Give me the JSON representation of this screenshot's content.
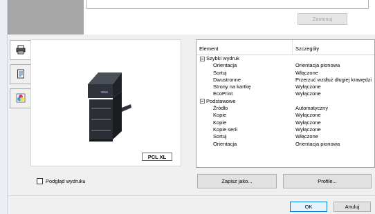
{
  "top": {
    "apply_label": "Zastosuj"
  },
  "tabs": [
    {
      "icon": "printer-settings-icon"
    },
    {
      "icon": "document-icon"
    },
    {
      "icon": "color-icon"
    }
  ],
  "preview": {
    "badge": "PCL XL"
  },
  "grid": {
    "headers": {
      "element": "Element",
      "details": "Szczegóły"
    },
    "rows": [
      {
        "type": "group",
        "element": "Szybki wydruk",
        "details": ""
      },
      {
        "type": "item",
        "element": "Orientacja",
        "details": "Orientacja pionowa"
      },
      {
        "type": "item",
        "element": "Sortuj",
        "details": "Włączone"
      },
      {
        "type": "item",
        "element": "Dwustronne",
        "details": "Przerzuć wzdłuż długiej krawędzi"
      },
      {
        "type": "item",
        "element": "Strony na kartkę",
        "details": "Wyłączone"
      },
      {
        "type": "item",
        "element": "EcoPrint",
        "details": "Wyłączone"
      },
      {
        "type": "group",
        "element": "Podstawowe",
        "details": ""
      },
      {
        "type": "item",
        "element": "Źródło",
        "details": "Automatyczny"
      },
      {
        "type": "item",
        "element": "Kopie",
        "details": "Wyłączone"
      },
      {
        "type": "item",
        "element": "Kopie",
        "details": "Wyłączone"
      },
      {
        "type": "item",
        "element": "Kopie serii",
        "details": "Wyłączone"
      },
      {
        "type": "item",
        "element": "Sortuj",
        "details": "Włączone"
      },
      {
        "type": "item",
        "element": "Orientacja",
        "details": "Orientacja pionowa"
      }
    ]
  },
  "footer": {
    "preview_checkbox_label": "Podgląd wydruku",
    "preview_checked": false,
    "save_as_label": "Zapisz jako...",
    "profile_label": "Profile...",
    "ok_label": "OK",
    "cancel_label": "Anuluj"
  }
}
